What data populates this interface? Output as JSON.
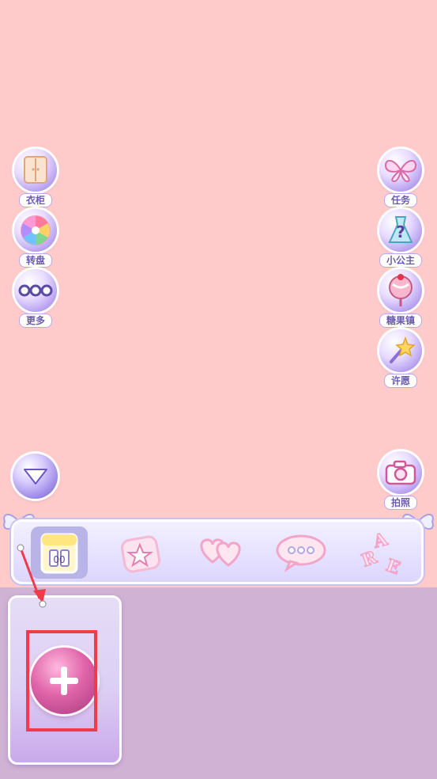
{
  "left_buttons": [
    {
      "label": "衣柜",
      "icon": "wardrobe-icon"
    },
    {
      "label": "转盘",
      "icon": "wheel-icon"
    },
    {
      "label": "更多",
      "icon": "more-dots-icon"
    }
  ],
  "right_buttons": [
    {
      "label": "任务",
      "icon": "butterfly-icon"
    },
    {
      "label": "小公主",
      "icon": "princess-dress-icon"
    },
    {
      "label": "糖果镇",
      "icon": "candy-icon"
    },
    {
      "label": "许愿",
      "icon": "wand-icon"
    }
  ],
  "camera_button": {
    "label": "拍照",
    "icon": "camera-icon"
  },
  "toolbar": {
    "tools": [
      "wardrobe-icon",
      "star-box-icon",
      "balloon-hearts-icon",
      "speech-bubble-icon",
      "abc-letters-icon"
    ],
    "active_index": 0
  },
  "card": {
    "icon": "plus-icon"
  },
  "colors": {
    "background": "#ffcaca",
    "panel": "#d0b2d5",
    "accent": "#6b5bb0",
    "highlight": "#ef3b4a"
  }
}
